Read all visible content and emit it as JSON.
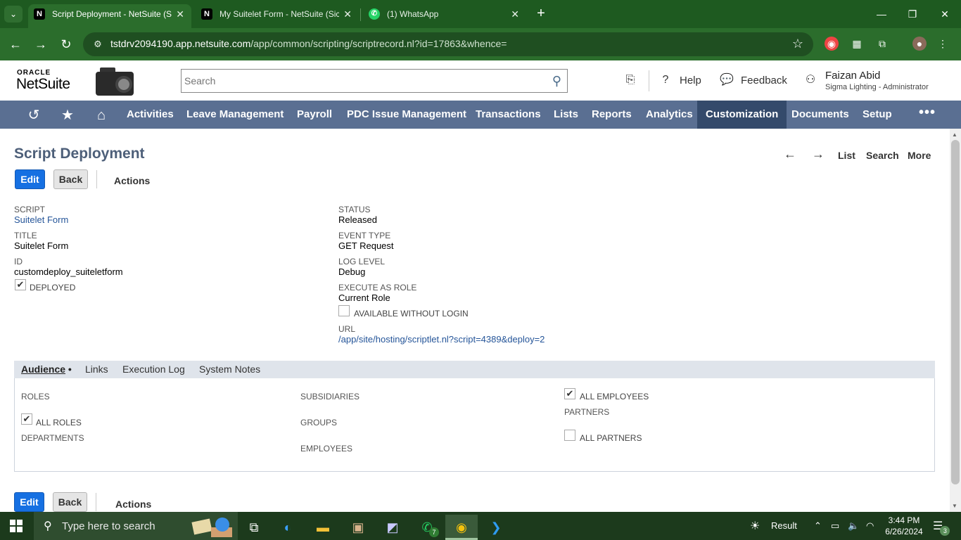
{
  "browser": {
    "tabs": [
      {
        "favicon": "N",
        "label": "Script Deployment - NetSuite (S",
        "active": true
      },
      {
        "favicon": "N",
        "label": "My Suitelet Form - NetSuite (Sic",
        "active": false
      },
      {
        "favicon": "whatsapp-icon",
        "label": "(1) WhatsApp",
        "active": false
      }
    ],
    "url_host": "tstdrv2094190.app.netsuite.com",
    "url_path": "/app/common/scripting/scriptrecord.nl?id=17863&whence="
  },
  "header": {
    "logo_top": "ORACLE",
    "logo_bottom": "NetSuite",
    "search_placeholder": "Search",
    "help_label": "Help",
    "feedback_label": "Feedback",
    "user_name": "Faizan Abid",
    "user_role": "Sigma Lighting - Administrator"
  },
  "nav": {
    "items": [
      "Activities",
      "Leave Management",
      "Payroll",
      "PDC Issue Management",
      "Transactions",
      "Lists",
      "Reports",
      "Analytics",
      "Customization",
      "Documents",
      "Setup"
    ],
    "active": "Customization",
    "more": "•••"
  },
  "page": {
    "title": "Script Deployment",
    "record_nav": {
      "list": "List",
      "search": "Search",
      "more": "More"
    },
    "buttons": {
      "edit": "Edit",
      "back": "Back",
      "actions": "Actions"
    }
  },
  "fields_left": {
    "script_label": "Script",
    "script_value": "Suitelet Form",
    "title_label": "Title",
    "title_value": "Suitelet Form",
    "id_label": "ID",
    "id_value": "customdeploy_suiteletform",
    "deployed_label": "Deployed",
    "deployed_checked": true
  },
  "fields_right": {
    "status_label": "Status",
    "status_value": "Released",
    "event_type_label": "Event Type",
    "event_type_value": "GET Request",
    "log_level_label": "Log Level",
    "log_level_value": "Debug",
    "execute_as_label": "Execute As Role",
    "execute_as_value": "Current Role",
    "available_label": "Available Without Login",
    "available_checked": false,
    "url_label": "URL",
    "url_value": "/app/site/hosting/scriptlet.nl?script=4389&deploy=2"
  },
  "subtabs": {
    "items": [
      "Audience",
      "Links",
      "Execution Log",
      "System Notes"
    ],
    "active": "Audience",
    "active_marker": "•"
  },
  "audience": {
    "roles_label": "Roles",
    "all_roles_label": "All Roles",
    "all_roles_checked": true,
    "departments_label": "Departments",
    "subsidiaries_label": "Subsidiaries",
    "groups_label": "Groups",
    "employees_label": "Employees",
    "all_employees_label": "All Employees",
    "all_employees_checked": true,
    "partners_label": "Partners",
    "all_partners_label": "All Partners",
    "all_partners_checked": false
  },
  "taskbar": {
    "search_placeholder": "Type here to search",
    "whatsapp_badge": "7",
    "weather_label": "Result",
    "time": "3:44 PM",
    "date": "6/26/2024",
    "notif_count": "3"
  }
}
